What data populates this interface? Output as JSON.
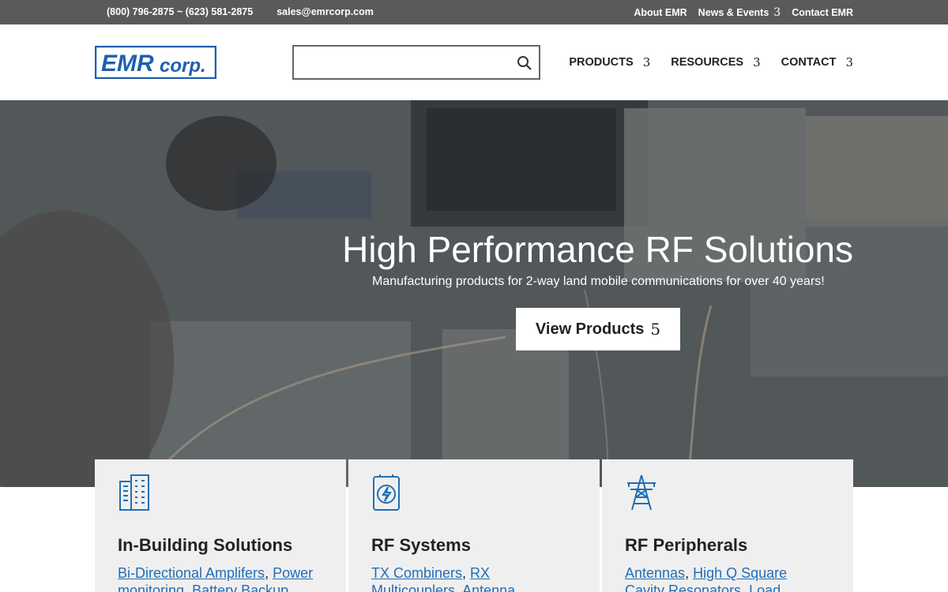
{
  "topbar": {
    "phone": "(800) 796-2875 ~ (623) 581-2875",
    "email": "sales@emrcorp.com",
    "links": [
      {
        "label": "About EMR",
        "caret": ""
      },
      {
        "label": "News & Events",
        "caret": "3"
      },
      {
        "label": "Contact EMR",
        "caret": ""
      }
    ]
  },
  "header": {
    "logo_text": "EMR corp.",
    "search": {
      "placeholder": "",
      "value": ""
    },
    "nav": [
      {
        "label": "PRODUCTS",
        "caret": "3"
      },
      {
        "label": "RESOURCES",
        "caret": "3"
      },
      {
        "label": "CONTACT",
        "caret": "3"
      }
    ]
  },
  "hero": {
    "title": "High Performance RF Solutions",
    "subtitle": "Manufacturing products for 2-way land mobile communications for over 40 years!",
    "button_label": "View Products",
    "button_arrow": "5"
  },
  "cards": [
    {
      "icon": "building-icon",
      "title": "In-Building Solutions",
      "links": [
        "Bi-Directional Amplifers",
        "Power monitoring",
        "Battery Backup"
      ]
    },
    {
      "icon": "battery-bolt-icon",
      "title": "RF Systems",
      "links": [
        "TX Combiners",
        "RX Multicouplers",
        "Antenna"
      ]
    },
    {
      "icon": "tower-icon",
      "title": "RF Peripherals",
      "links": [
        "Antennas",
        "High Q Square Cavity Resonators",
        "Load Terminations"
      ]
    }
  ],
  "colors": {
    "accent": "#1f6fb5",
    "topbar": "#5a5a5a",
    "card_bg": "#f0eff0"
  }
}
